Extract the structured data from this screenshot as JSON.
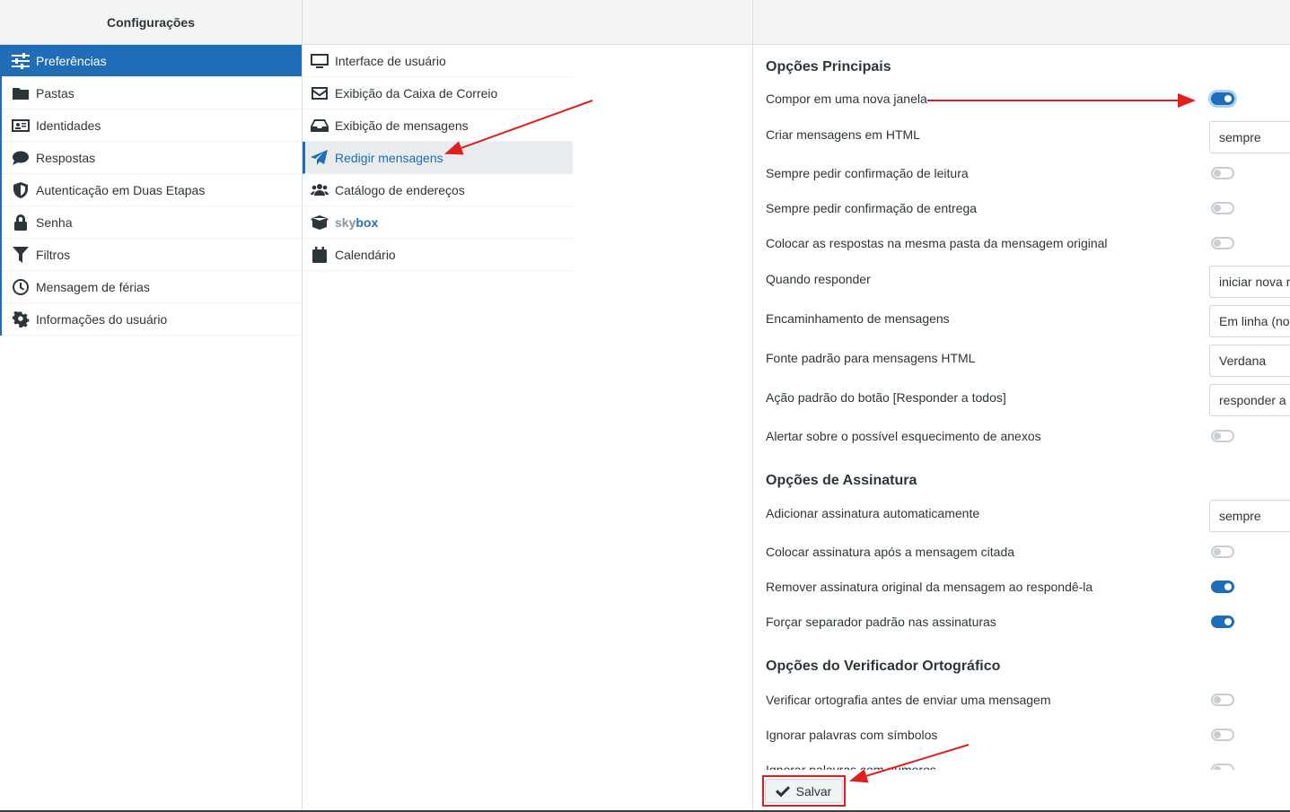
{
  "settings_panel": {
    "title": "Configurações"
  },
  "sections": [
    {
      "label": "Preferências",
      "icon": "sliders-icon"
    },
    {
      "label": "Pastas",
      "icon": "folder-icon"
    },
    {
      "label": "Identidades",
      "icon": "id-card-icon"
    },
    {
      "label": "Respostas",
      "icon": "comment-icon"
    },
    {
      "label": "Autenticação em Duas Etapas",
      "icon": "shield-icon"
    },
    {
      "label": "Senha",
      "icon": "lock-icon"
    },
    {
      "label": "Filtros",
      "icon": "filter-icon"
    },
    {
      "label": "Mensagem de férias",
      "icon": "clock-icon"
    },
    {
      "label": "Informações do usuário",
      "icon": "gear-icon"
    }
  ],
  "preference_sections": [
    {
      "label": "Interface de usuário",
      "icon": "monitor-icon"
    },
    {
      "label": "Exibição da Caixa de Correio",
      "icon": "envelope-icon"
    },
    {
      "label": "Exibição de mensagens",
      "icon": "inbox-icon"
    },
    {
      "label": "Redigir mensagens",
      "icon": "paper-plane-icon"
    },
    {
      "label": "Catálogo de endereços",
      "icon": "users-icon"
    },
    {
      "label_prefix": "sky",
      "label_suffix": "box",
      "icon": "box-icon"
    },
    {
      "label": "Calendário",
      "icon": "calendar-icon"
    }
  ],
  "main": {
    "section1_title": "Opções Principais",
    "section2_title": "Opções de Assinatura",
    "section3_title": "Opções do Verificador Ortográfico",
    "compose_new_window": {
      "label": "Compor em uma nova janela",
      "on": true
    },
    "html_compose": {
      "label": "Criar mensagens em HTML",
      "value": "sempre"
    },
    "read_receipt": {
      "label": "Sempre pedir confirmação de leitura",
      "on": false
    },
    "delivery_receipt": {
      "label": "Sempre pedir confirmação de entrega",
      "on": false
    },
    "reply_same_folder": {
      "label": "Colocar as respostas na mesma pasta da mensagem original",
      "on": false
    },
    "when_replying": {
      "label": "Quando responder",
      "value": "iniciar nova me"
    },
    "forwarding": {
      "label": "Encaminhamento de mensagens",
      "value": "Em linha (no co"
    },
    "default_font": {
      "label": "Fonte padrão para mensagens HTML",
      "value": "Verdana"
    },
    "reply_all_default": {
      "label": "Ação padrão do botão [Responder a todos]",
      "value": "responder a tod"
    },
    "attachment_reminder": {
      "label": "Alertar sobre o possível esquecimento de anexos",
      "on": false
    },
    "auto_signature": {
      "label": "Adicionar assinatura automaticamente",
      "value": "sempre"
    },
    "sig_below_quote": {
      "label": "Colocar assinatura após a mensagem citada",
      "on": false
    },
    "strip_signature": {
      "label": "Remover assinatura original da mensagem ao respondê-la",
      "on": true
    },
    "force_separator": {
      "label": "Forçar separador padrão nas assinaturas",
      "on": true
    },
    "spell_before_send": {
      "label": "Verificar ortografia antes de enviar uma mensagem",
      "on": false
    },
    "ignore_symbols": {
      "label": "Ignorar palavras com símbolos",
      "on": false
    },
    "ignore_numbers": {
      "label": "Ignorar palavras com números",
      "on": false
    }
  },
  "footer": {
    "save_label": "Salvar"
  },
  "colors": {
    "accent": "#1f6db6",
    "annotation": "#e11d1d"
  }
}
